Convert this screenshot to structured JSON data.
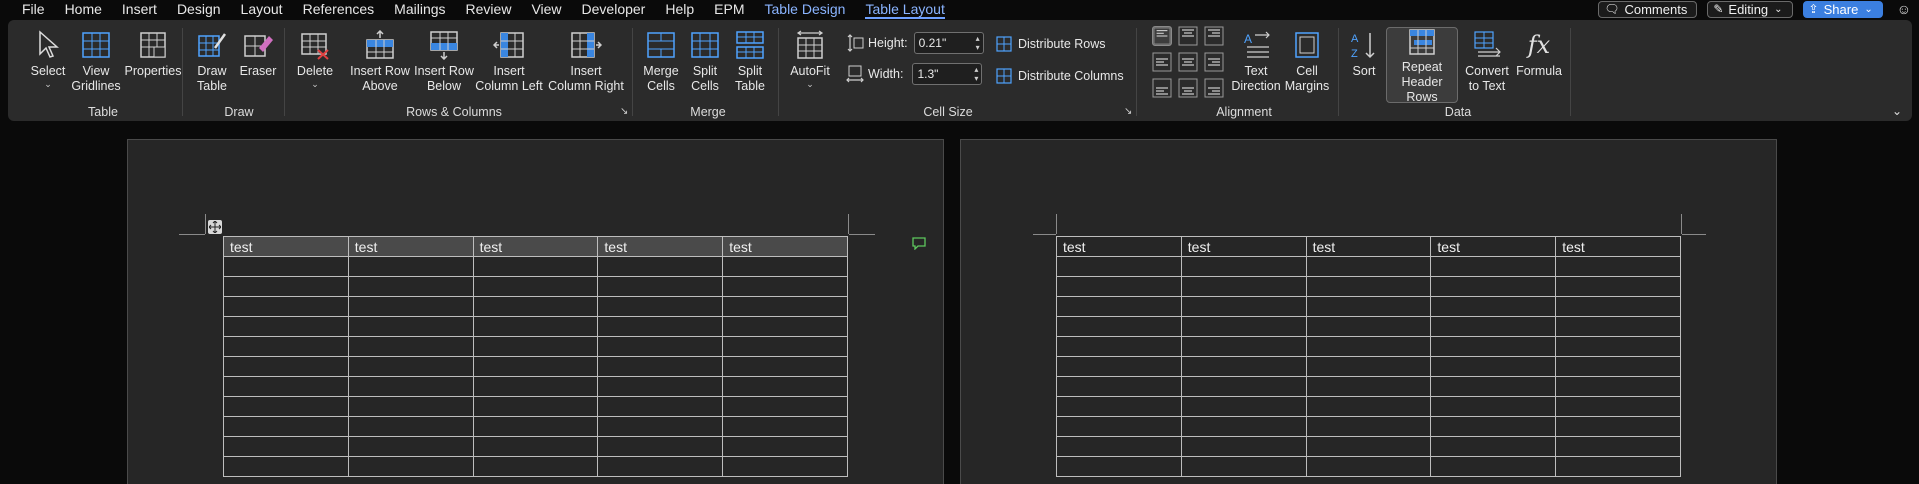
{
  "menubar": {
    "items": [
      {
        "label": "File",
        "kind": "normal"
      },
      {
        "label": "Home",
        "kind": "normal"
      },
      {
        "label": "Insert",
        "kind": "normal"
      },
      {
        "label": "Design",
        "kind": "normal"
      },
      {
        "label": "Layout",
        "kind": "normal"
      },
      {
        "label": "References",
        "kind": "normal"
      },
      {
        "label": "Mailings",
        "kind": "normal"
      },
      {
        "label": "Review",
        "kind": "normal"
      },
      {
        "label": "View",
        "kind": "normal"
      },
      {
        "label": "Developer",
        "kind": "normal"
      },
      {
        "label": "Help",
        "kind": "normal"
      },
      {
        "label": "EPM",
        "kind": "normal"
      },
      {
        "label": "Table Design",
        "kind": "ctx"
      },
      {
        "label": "Table Layout",
        "kind": "active"
      }
    ],
    "comments_label": "Comments",
    "editing_label": "Editing",
    "share_label": "Share",
    "accent_color": "#8ab4ff",
    "share_color": "#3b7fe0"
  },
  "ribbon": {
    "select": {
      "label": "Select"
    },
    "view_gridlines": {
      "line1": "View",
      "line2": "Gridlines"
    },
    "properties": {
      "label": "Properties"
    },
    "group_table": "Table",
    "draw_table": {
      "line1": "Draw",
      "line2": "Table"
    },
    "eraser": {
      "label": "Eraser"
    },
    "group_draw": "Draw",
    "delete": {
      "label": "Delete"
    },
    "insert_row_above": {
      "line1": "Insert Row",
      "line2": "Above"
    },
    "insert_row_below": {
      "line1": "Insert Row",
      "line2": "Below"
    },
    "insert_col_left": {
      "line1": "Insert",
      "line2": "Column Left"
    },
    "insert_col_right": {
      "line1": "Insert",
      "line2": "Column Right"
    },
    "group_rows_cols": "Rows & Columns",
    "merge_cells": {
      "line1": "Merge",
      "line2": "Cells"
    },
    "split_cells": {
      "line1": "Split",
      "line2": "Cells"
    },
    "split_table": {
      "line1": "Split",
      "line2": "Table"
    },
    "group_merge": "Merge",
    "autofit": {
      "label": "AutoFit"
    },
    "height": {
      "label": "Height:",
      "value": "0.21\""
    },
    "width": {
      "label": "Width:",
      "value": "1.3\""
    },
    "distribute_rows": "Distribute Rows",
    "distribute_columns": "Distribute Columns",
    "group_cell_size": "Cell Size",
    "text_direction": {
      "line1": "Text",
      "line2": "Direction"
    },
    "cell_margins": {
      "line1": "Cell",
      "line2": "Margins"
    },
    "group_alignment": "Alignment",
    "sort": {
      "label": "Sort"
    },
    "repeat_header_rows": {
      "line1": "Repeat",
      "line2": "Header Rows"
    },
    "convert_to_text": {
      "line1": "Convert",
      "line2": "to Text"
    },
    "formula": {
      "label": "Formula"
    },
    "group_data": "Data"
  },
  "document": {
    "page1": {
      "header_cells": [
        "test",
        "test",
        "test",
        "test",
        "test"
      ],
      "empty_rows": 11
    },
    "page2": {
      "header_cells": [
        "test",
        "test",
        "test",
        "test",
        "test"
      ],
      "empty_rows": 11
    }
  }
}
